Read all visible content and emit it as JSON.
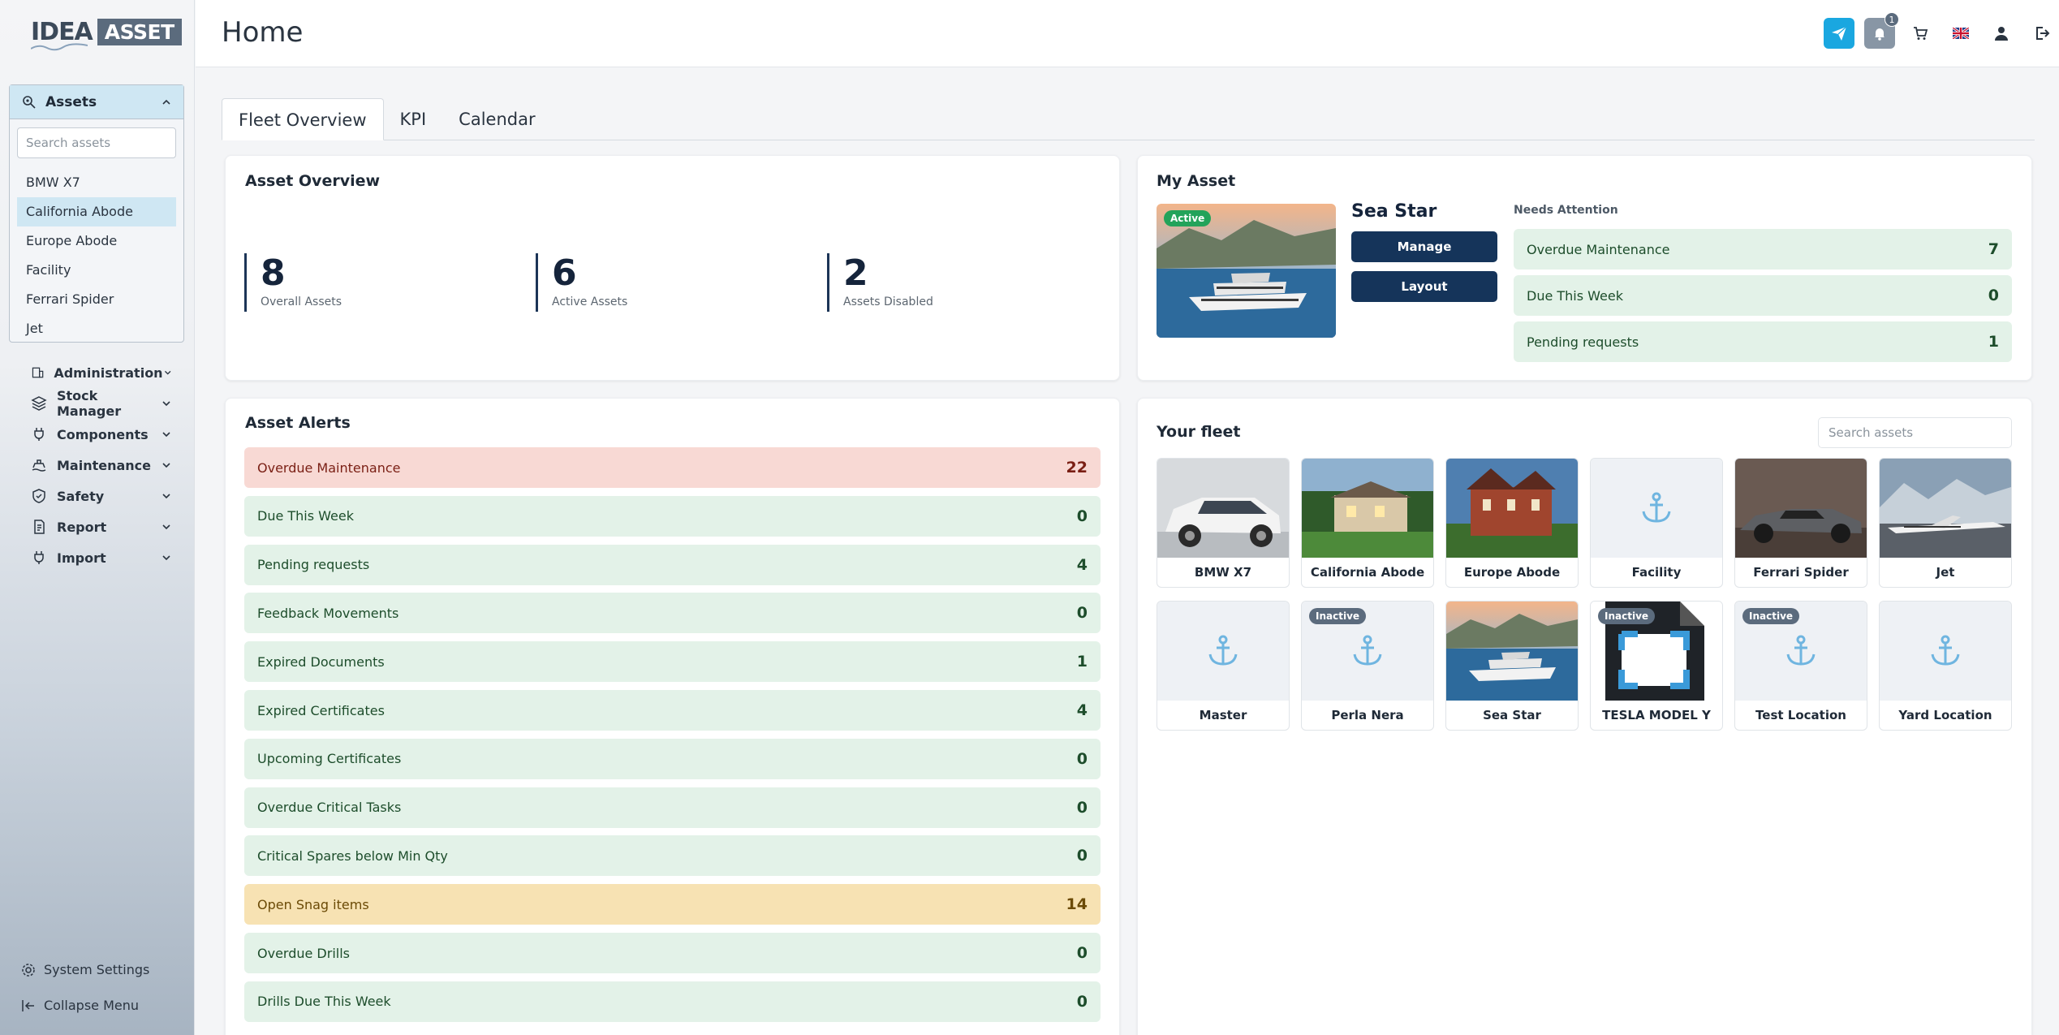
{
  "logo": {
    "word1": "IDEA",
    "word2": "ASSET"
  },
  "sidebar": {
    "assets_label": "Assets",
    "search_placeholder": "Search assets",
    "asset_list": [
      "BMW X7",
      "California Abode",
      "Europe Abode",
      "Facility",
      "Ferrari Spider",
      "Jet"
    ],
    "selected_asset": "California Abode",
    "nav": [
      {
        "label": "Administration",
        "icon": "building-icon"
      },
      {
        "label": "Stock Manager",
        "icon": "layers-icon"
      },
      {
        "label": "Components",
        "icon": "plug-icon"
      },
      {
        "label": "Maintenance",
        "icon": "ship-icon"
      },
      {
        "label": "Safety",
        "icon": "shield-icon"
      },
      {
        "label": "Report",
        "icon": "document-icon"
      },
      {
        "label": "Import",
        "icon": "plug-icon"
      }
    ],
    "system_settings": "System Settings",
    "collapse_menu": "Collapse Menu"
  },
  "header": {
    "title": "Home",
    "notification_count": "1"
  },
  "tabs": [
    "Fleet Overview",
    "KPI",
    "Calendar"
  ],
  "asset_overview": {
    "title": "Asset Overview",
    "stats": [
      {
        "value": "8",
        "label": "Overall Assets"
      },
      {
        "value": "6",
        "label": "Active Assets"
      },
      {
        "value": "2",
        "label": "Assets Disabled"
      }
    ]
  },
  "my_asset": {
    "title": "My Asset",
    "status": "Active",
    "name": "Sea Star",
    "manage_label": "Manage",
    "layout_label": "Layout",
    "needs_attention": "Needs Attention",
    "items": [
      {
        "label": "Overdue Maintenance",
        "value": "7"
      },
      {
        "label": "Due This Week",
        "value": "0"
      },
      {
        "label": "Pending requests",
        "value": "1"
      }
    ]
  },
  "asset_alerts": {
    "title": "Asset Alerts",
    "items": [
      {
        "label": "Overdue Maintenance",
        "value": "22",
        "tone": "red"
      },
      {
        "label": "Due This Week",
        "value": "0",
        "tone": "green"
      },
      {
        "label": "Pending requests",
        "value": "4",
        "tone": "green"
      },
      {
        "label": "Feedback Movements",
        "value": "0",
        "tone": "green"
      },
      {
        "label": "Expired Documents",
        "value": "1",
        "tone": "green"
      },
      {
        "label": "Expired Certificates",
        "value": "4",
        "tone": "green"
      },
      {
        "label": "Upcoming Certificates",
        "value": "0",
        "tone": "green"
      },
      {
        "label": "Overdue Critical Tasks",
        "value": "0",
        "tone": "green"
      },
      {
        "label": "Critical Spares below Min Qty",
        "value": "0",
        "tone": "green"
      },
      {
        "label": "Open Snag items",
        "value": "14",
        "tone": "yellow"
      },
      {
        "label": "Overdue Drills",
        "value": "0",
        "tone": "green"
      },
      {
        "label": "Drills Due This Week",
        "value": "0",
        "tone": "green"
      }
    ]
  },
  "fleet": {
    "title": "Your fleet",
    "search_placeholder": "Search assets",
    "inactive_label": "Inactive",
    "items": [
      {
        "name": "BMW X7",
        "img": "car",
        "inactive": false
      },
      {
        "name": "California Abode",
        "img": "house",
        "inactive": false
      },
      {
        "name": "Europe Abode",
        "img": "mansion",
        "inactive": false
      },
      {
        "name": "Facility",
        "img": "anchor",
        "inactive": false
      },
      {
        "name": "Ferrari Spider",
        "img": "sportscar",
        "inactive": false
      },
      {
        "name": "Jet",
        "img": "jet",
        "inactive": false
      },
      {
        "name": "Master",
        "img": "anchor",
        "inactive": false
      },
      {
        "name": "Perla Nera",
        "img": "anchor",
        "inactive": true
      },
      {
        "name": "Sea Star",
        "img": "yacht",
        "inactive": false
      },
      {
        "name": "TESLA MODEL Y",
        "img": "broken",
        "inactive": true
      },
      {
        "name": "Test Location",
        "img": "anchor",
        "inactive": true
      },
      {
        "name": "Yard Location",
        "img": "anchor",
        "inactive": false
      }
    ]
  }
}
